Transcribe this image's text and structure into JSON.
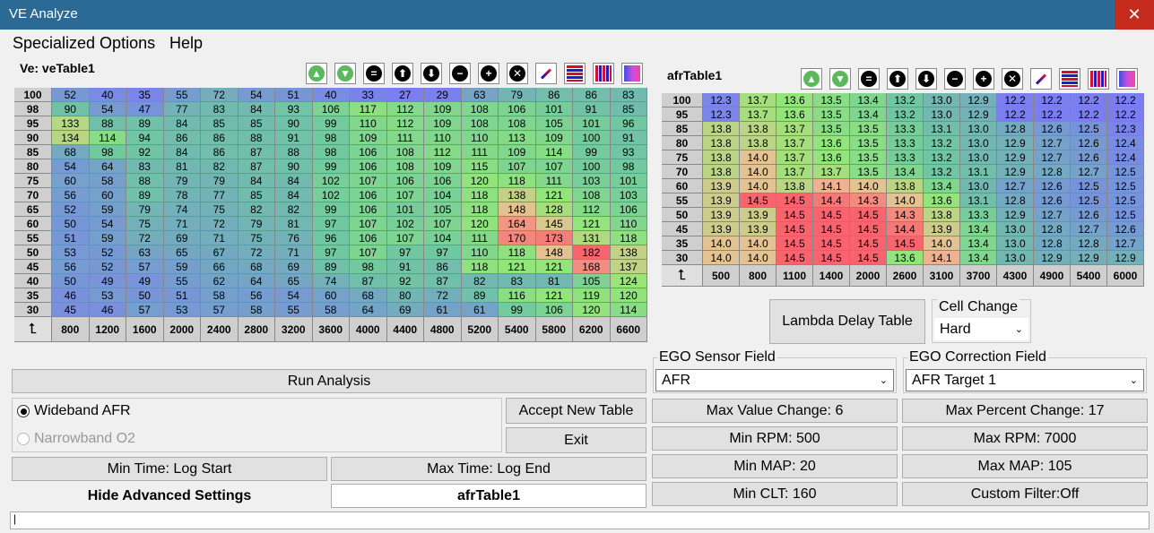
{
  "window": {
    "title": "VE Analyze",
    "close_glyph": "✕"
  },
  "menu": [
    "Specialized Options",
    "Help"
  ],
  "ve": {
    "title": "Ve: veTable1",
    "corner_glyph": "⮤",
    "rows": [
      100,
      98,
      95,
      90,
      85,
      80,
      75,
      70,
      65,
      60,
      55,
      50,
      45,
      40,
      35,
      30
    ],
    "cols": [
      800,
      1200,
      1600,
      2000,
      2400,
      2800,
      3200,
      3600,
      4000,
      4400,
      4800,
      5200,
      5400,
      5800,
      6200,
      6600
    ],
    "values": [
      [
        52,
        40,
        35,
        55,
        72,
        54,
        51,
        40,
        33,
        27,
        29,
        63,
        79,
        86,
        86,
        83
      ],
      [
        90,
        54,
        47,
        77,
        83,
        84,
        93,
        106,
        117,
        112,
        109,
        108,
        106,
        101,
        91,
        85
      ],
      [
        133,
        88,
        89,
        84,
        85,
        85,
        90,
        99,
        110,
        112,
        109,
        108,
        108,
        105,
        101,
        96
      ],
      [
        134,
        114,
        94,
        86,
        86,
        88,
        91,
        98,
        109,
        111,
        110,
        110,
        113,
        109,
        100,
        91
      ],
      [
        68,
        98,
        92,
        84,
        86,
        87,
        88,
        98,
        106,
        108,
        112,
        111,
        109,
        114,
        99,
        93
      ],
      [
        54,
        64,
        83,
        81,
        82,
        87,
        90,
        99,
        106,
        108,
        109,
        115,
        107,
        107,
        100,
        98
      ],
      [
        60,
        58,
        88,
        79,
        79,
        84,
        84,
        102,
        107,
        106,
        106,
        120,
        118,
        111,
        103,
        101
      ],
      [
        56,
        60,
        89,
        78,
        77,
        85,
        84,
        102,
        106,
        107,
        104,
        118,
        138,
        121,
        108,
        103
      ],
      [
        52,
        59,
        79,
        74,
        75,
        82,
        82,
        99,
        106,
        101,
        105,
        118,
        148,
        128,
        112,
        106
      ],
      [
        50,
        54,
        75,
        71,
        72,
        79,
        81,
        97,
        107,
        102,
        107,
        120,
        164,
        145,
        121,
        110
      ],
      [
        51,
        59,
        72,
        69,
        71,
        75,
        76,
        96,
        106,
        107,
        104,
        111,
        170,
        173,
        131,
        118
      ],
      [
        53,
        52,
        63,
        65,
        67,
        72,
        71,
        97,
        107,
        97,
        97,
        110,
        118,
        148,
        182,
        138
      ],
      [
        56,
        52,
        57,
        59,
        66,
        68,
        69,
        89,
        98,
        91,
        86,
        118,
        121,
        121,
        168,
        137
      ],
      [
        50,
        49,
        49,
        55,
        62,
        64,
        65,
        74,
        87,
        92,
        87,
        82,
        83,
        81,
        105,
        124
      ],
      [
        46,
        53,
        50,
        51,
        58,
        56,
        54,
        60,
        68,
        80,
        72,
        89,
        116,
        121,
        119,
        120
      ],
      [
        45,
        46,
        57,
        53,
        57,
        58,
        55,
        58,
        64,
        69,
        61,
        61,
        99,
        106,
        120,
        114
      ]
    ]
  },
  "afr": {
    "title": "afrTable1",
    "corner_glyph": "⮤",
    "rows": [
      100,
      95,
      85,
      80,
      75,
      70,
      60,
      55,
      50,
      45,
      35,
      30
    ],
    "cols": [
      500,
      800,
      1100,
      1400,
      2000,
      2600,
      3100,
      3700,
      4300,
      4900,
      5400,
      6000
    ],
    "values": [
      [
        "12.3",
        "13.7",
        "13.6",
        "13.5",
        "13.4",
        "13.2",
        "13.0",
        "12.9",
        "12.2",
        "12.2",
        "12.2",
        "12.2"
      ],
      [
        "12.3",
        "13.7",
        "13.6",
        "13.5",
        "13.4",
        "13.2",
        "13.0",
        "12.9",
        "12.2",
        "12.2",
        "12.2",
        "12.2"
      ],
      [
        "13.8",
        "13.8",
        "13.7",
        "13.5",
        "13.5",
        "13.3",
        "13.1",
        "13.0",
        "12.8",
        "12.6",
        "12.5",
        "12.3"
      ],
      [
        "13.8",
        "13.8",
        "13.7",
        "13.6",
        "13.5",
        "13.3",
        "13.2",
        "13.0",
        "12.9",
        "12.7",
        "12.6",
        "12.4"
      ],
      [
        "13.8",
        "14.0",
        "13.7",
        "13.6",
        "13.5",
        "13.3",
        "13.2",
        "13.0",
        "12.9",
        "12.7",
        "12.6",
        "12.4"
      ],
      [
        "13.8",
        "14.0",
        "13.7",
        "13.7",
        "13.5",
        "13.4",
        "13.2",
        "13.1",
        "12.9",
        "12.8",
        "12.7",
        "12.5"
      ],
      [
        "13.9",
        "14.0",
        "13.8",
        "14.1",
        "14.0",
        "13.8",
        "13.4",
        "13.0",
        "12.7",
        "12.6",
        "12.5",
        "12.5"
      ],
      [
        "13.9",
        "14.5",
        "14.5",
        "14.4",
        "14.3",
        "14.0",
        "13.6",
        "13.1",
        "12.8",
        "12.6",
        "12.5",
        "12.5"
      ],
      [
        "13.9",
        "13.9",
        "14.5",
        "14.5",
        "14.5",
        "14.3",
        "13.8",
        "13.3",
        "12.9",
        "12.7",
        "12.6",
        "12.5"
      ],
      [
        "13.9",
        "13.9",
        "14.5",
        "14.5",
        "14.5",
        "14.4",
        "13.9",
        "13.4",
        "13.0",
        "12.8",
        "12.7",
        "12.6"
      ],
      [
        "14.0",
        "14.0",
        "14.5",
        "14.5",
        "14.5",
        "14.5",
        "14.0",
        "13.4",
        "13.0",
        "12.8",
        "12.8",
        "12.7"
      ],
      [
        "14.0",
        "14.0",
        "14.5",
        "14.5",
        "14.5",
        "13.6",
        "14.1",
        "13.4",
        "13.0",
        "12.9",
        "12.9",
        "12.9"
      ]
    ]
  },
  "toolbar_icons": [
    {
      "name": "increment-icon",
      "glyph": "▲",
      "bg": "#5cb85c"
    },
    {
      "name": "decrement-icon",
      "glyph": "▼",
      "bg": "#5cb85c"
    },
    {
      "name": "set-equal-icon",
      "glyph": "=",
      "bg": "#000000"
    },
    {
      "name": "arrow-up-icon",
      "glyph": "⬆",
      "bg": "#000000"
    },
    {
      "name": "arrow-down-icon",
      "glyph": "⬇",
      "bg": "#000000"
    },
    {
      "name": "minus-icon",
      "glyph": "−",
      "bg": "#000000"
    },
    {
      "name": "plus-icon",
      "glyph": "+",
      "bg": "#000000"
    },
    {
      "name": "multiply-icon",
      "glyph": "✕",
      "bg": "#000000"
    },
    {
      "name": "interpolate-icon",
      "glyph": "",
      "bg": ""
    },
    {
      "name": "interpolate-horizontal-icon",
      "glyph": "",
      "bg": ""
    },
    {
      "name": "interpolate-vertical-icon",
      "glyph": "",
      "bg": ""
    },
    {
      "name": "smooth-icon",
      "glyph": "",
      "bg": ""
    }
  ],
  "buttons": {
    "lambda_delay": "Lambda Delay Table",
    "run_analysis": "Run Analysis",
    "accept_new_table": "Accept New Table",
    "exit": "Exit",
    "min_time": "Min Time: Log Start",
    "max_time": "Max Time: Log End",
    "hide_advanced": "Hide Advanced Settings",
    "target_table": "afrTable1",
    "max_value_change": "Max Value Change: 6",
    "max_percent_change": "Max Percent Change: 17",
    "min_rpm": "Min RPM: 500",
    "max_rpm": "Max RPM: 7000",
    "min_map": "Min MAP: 20",
    "max_map": "Max MAP: 105",
    "min_clt": "Min CLT: 160",
    "custom_filter": "Custom Filter:Off"
  },
  "cell_change": {
    "label": "Cell Change",
    "value": "Hard"
  },
  "ego_sensor": {
    "label": "EGO Sensor Field",
    "value": "AFR"
  },
  "ego_correction": {
    "label": "EGO Correction Field",
    "value": "AFR Target 1"
  },
  "radios": {
    "wideband": "Wideband AFR",
    "narrowband": "Narrowband O2",
    "selected": "wideband"
  },
  "status": {
    "text": "|"
  },
  "colors": {
    "titlebar": "#2a6a94",
    "close": "#c42b1c"
  }
}
